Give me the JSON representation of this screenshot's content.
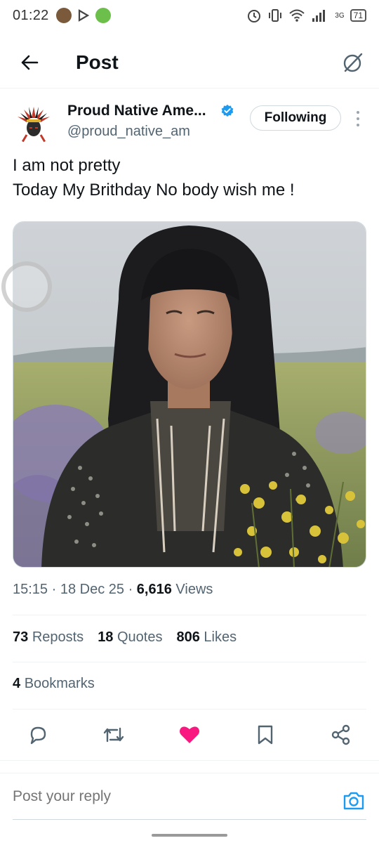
{
  "status_bar": {
    "time": "01:22",
    "network": "3G",
    "battery": "71"
  },
  "header": {
    "back_icon": "arrow-left-icon",
    "title": "Post",
    "grok_icon": "grok-icon"
  },
  "author": {
    "name": "Proud Native Ame...",
    "handle": "@proud_native_am",
    "verified": true,
    "follow_label": "Following"
  },
  "post": {
    "lines": [
      "I am not pretty",
      "Today My Brithday No body wish me !"
    ]
  },
  "meta": {
    "time": "15:15",
    "date": "18 Dec 25",
    "views_count": "6,616",
    "views_label": "Views"
  },
  "stats": {
    "reposts_count": "73",
    "reposts_label": "Reposts",
    "quotes_count": "18",
    "quotes_label": "Quotes",
    "likes_count": "806",
    "likes_label": "Likes",
    "bookmarks_count": "4",
    "bookmarks_label": "Bookmarks"
  },
  "actions": [
    "reply-icon",
    "repost-icon",
    "like-icon",
    "bookmark-icon",
    "share-icon"
  ],
  "reply": {
    "placeholder": "Post your reply"
  },
  "colors": {
    "like_active": "#f91880",
    "verified_blue": "#1d9bf0",
    "secondary_text": "#536471"
  }
}
